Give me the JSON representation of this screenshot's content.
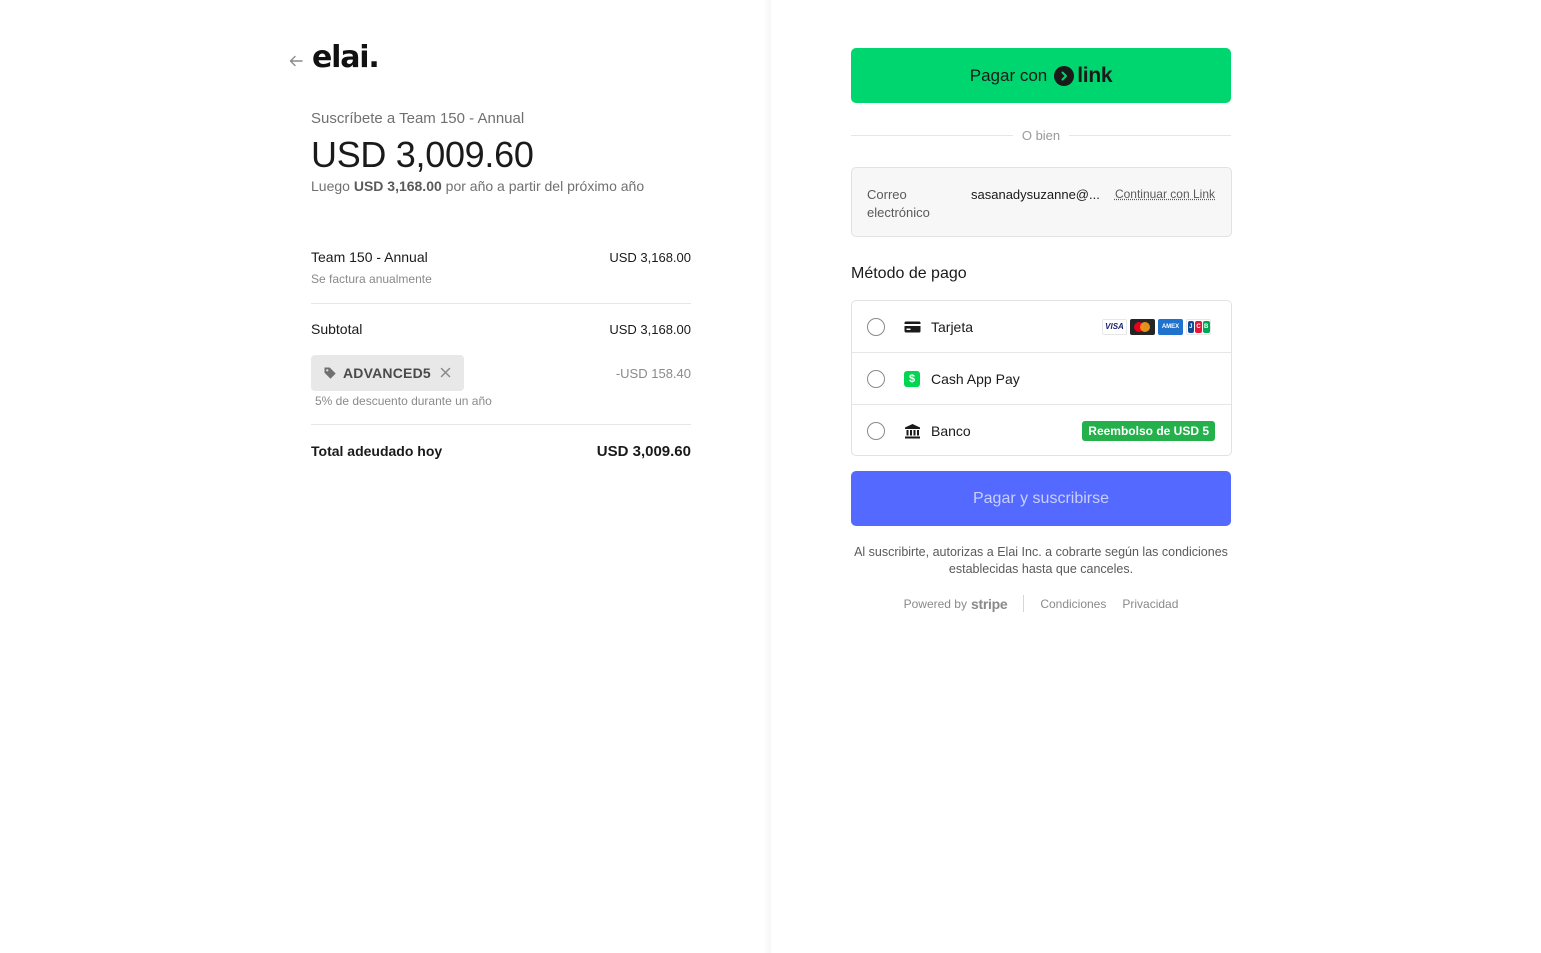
{
  "brand": {
    "logo_text": "elai."
  },
  "summary": {
    "subscribe_title": "Suscríbete a Team 150 - Annual",
    "amount": "USD 3,009.60",
    "then_prefix": "Luego",
    "then_amount": "USD 3,168.00",
    "then_suffix": "por año a partir del próximo año"
  },
  "line_item": {
    "name": "Team 150 - Annual",
    "price": "USD 3,168.00",
    "billing_note": "Se factura anualmente"
  },
  "subtotal": {
    "label": "Subtotal",
    "amount": "USD 3,168.00"
  },
  "promo": {
    "code": "ADVANCED5",
    "discount_amount": "-USD 158.40",
    "description": "5% de descuento durante un año"
  },
  "total": {
    "label": "Total adeudado hoy",
    "amount": "USD 3,009.60"
  },
  "link_button": {
    "label": "Pagar con",
    "brand": "link",
    "bg_color": "#00d66f"
  },
  "separator_text": "O bien",
  "email": {
    "label": "Correo electrónico",
    "value": "sasanadysuzanne@...",
    "continue_link": "Continuar con Link"
  },
  "payment": {
    "title": "Método de pago",
    "methods": [
      {
        "label": "Tarjeta",
        "icon": "credit-card-icon"
      },
      {
        "label": "Cash App Pay",
        "icon": "cash-app-icon"
      },
      {
        "label": "Banco",
        "icon": "bank-icon",
        "badge": "Reembolso de USD 5"
      }
    ],
    "cards": [
      "VISA",
      "mastercard",
      "AMEX",
      "JCB"
    ]
  },
  "pay_button": {
    "label": "Pagar y suscribirse",
    "bg_color": "#5469ff"
  },
  "legal_text": "Al suscribirte, autorizas a Elai Inc. a cobrarte según las condiciones establecidas hasta que canceles.",
  "footer": {
    "powered_by": "Powered by",
    "stripe": "stripe",
    "terms": "Condiciones",
    "privacy": "Privacidad"
  }
}
